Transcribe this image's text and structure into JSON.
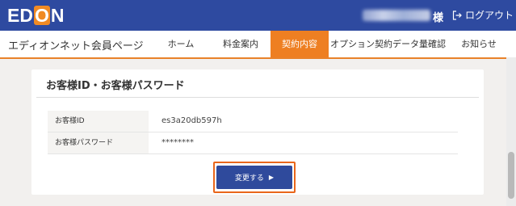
{
  "header": {
    "logo": {
      "pre": "ED",
      "accent": "O",
      "post": "N"
    },
    "user_honorific": "様",
    "logout_label": "ログアウト"
  },
  "nav": {
    "site_title": "エディオンネット会員ページ",
    "items": [
      {
        "label": "ホーム"
      },
      {
        "label": "料金案内"
      },
      {
        "label": "契約内容",
        "active": true
      },
      {
        "label": "オプション契約"
      },
      {
        "label": "データ量確認"
      },
      {
        "label": "お知らせ"
      }
    ]
  },
  "card": {
    "title": "お客様ID・お客様パスワード",
    "rows": [
      {
        "label": "お客様ID",
        "value": "es3a20db597h"
      },
      {
        "label": "お客様パスワード",
        "value": "********"
      }
    ],
    "change_button": "変更する"
  },
  "colors": {
    "brand_blue": "#2e4aa0",
    "accent_orange": "#ee7f22"
  }
}
